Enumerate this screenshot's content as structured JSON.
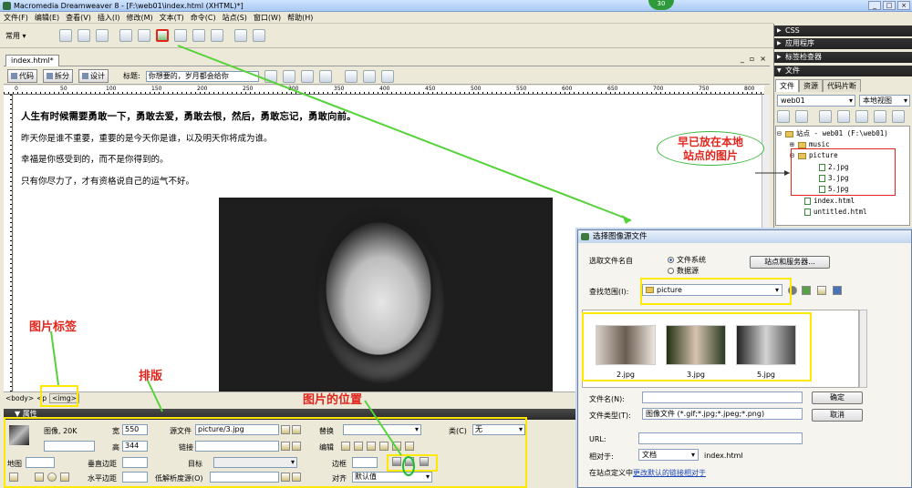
{
  "app": {
    "title": "Macromedia Dreamweaver 8 - [F:\\web01\\index.html (XHTML)*]",
    "badge": "30",
    "window_controls": [
      "_",
      "□",
      "×"
    ]
  },
  "menu": [
    "文件(F)",
    "编辑(E)",
    "查看(V)",
    "插入(I)",
    "修改(M)",
    "文本(T)",
    "命令(C)",
    "站点(S)",
    "窗口(W)",
    "帮助(H)"
  ],
  "insert_bar": {
    "category": "常用"
  },
  "document": {
    "tab": "index.html*",
    "window_buttons": [
      "_",
      "▫",
      "×"
    ],
    "view_buttons": {
      "code": "代码",
      "split": "拆分",
      "design": "设计"
    },
    "title_label": "标题:",
    "title_value": "你想要的，岁月都会给你",
    "ruler_labels": [
      "0",
      "50",
      "100",
      "150",
      "200",
      "250",
      "300",
      "350",
      "400",
      "450",
      "500",
      "550",
      "600",
      "650",
      "700",
      "750",
      "800"
    ],
    "heading": "人生有时候需要勇敢一下，勇敢去爱，勇敢去恨，然后，勇敢忘记，勇敢向前。",
    "paragraphs": [
      "昨天你是谁不重要，重要的是今天你是谁，以及明天你将成为谁。",
      "幸福是你感受到的，而不是你得到的。",
      "只有你尽力了，才有资格说自己的运气不好。"
    ],
    "tag_selector": {
      "body": "<body>",
      "p": "<p",
      "img": "<img>"
    }
  },
  "properties": {
    "header": "属性",
    "image_label": "图像, 20K",
    "width_label": "宽",
    "width_value": "550",
    "height_label": "高",
    "height_value": "344",
    "src_label": "源文件",
    "src_value": "picture/3.jpg",
    "link_label": "链接",
    "alt_label": "替换",
    "class_label": "类(C)",
    "class_value": "无",
    "edit_label": "编辑",
    "map_label": "地图",
    "vspace_label": "垂直边距",
    "target_label": "目标",
    "border_label": "边框",
    "hspace_label": "水平边距",
    "lowsrc_label": "低解析度源(O)",
    "align_label": "对齐",
    "align_value": "默认值"
  },
  "right_panel": {
    "groups": [
      "CSS",
      "应用程序",
      "标签检查器",
      "文件"
    ],
    "file_tabs": [
      "文件",
      "资源",
      "代码片断"
    ],
    "site_select": "web01",
    "view_select": "本地视图",
    "tree": {
      "root": "站点 - web01 (F:\\web01)",
      "music": "music",
      "picture": "picture",
      "files": [
        "2.jpg",
        "3.jpg",
        "5.jpg"
      ],
      "index": "index.html",
      "untitled": "untitled.html"
    }
  },
  "dialog": {
    "title": "选择图像源文件",
    "select_from_label": "选取文件名自",
    "option_filesystem": "文件系统",
    "option_datasource": "数据源",
    "site_server_button": "站点和服务器...",
    "lookin_label": "查找范围(I):",
    "lookin_value": "picture",
    "thumbnails": [
      "2.jpg",
      "3.jpg",
      "5.jpg"
    ],
    "filename_label": "文件名(N):",
    "filetype_label": "文件类型(T):",
    "filetype_value": "图像文件 (*.gif;*.jpg;*.jpeg;*.png)",
    "ok_button": "确定",
    "cancel_button": "取消",
    "url_label": "URL:",
    "relative_label": "相对于:",
    "relative_value": "文档",
    "relative_file": "index.html",
    "footer_prefix": "在站点定义中",
    "footer_link": "更改默认的链接相对于"
  },
  "annotations": {
    "bubble_line1": "早已放在本地",
    "bubble_line2": "站点的图片",
    "img_tag": "图片标签",
    "layout": "排版",
    "img_position": "图片的位置"
  },
  "colors": {
    "annotation_text": "#e0261c",
    "highlight": "#ffe900",
    "arrow": "#56d23a"
  }
}
